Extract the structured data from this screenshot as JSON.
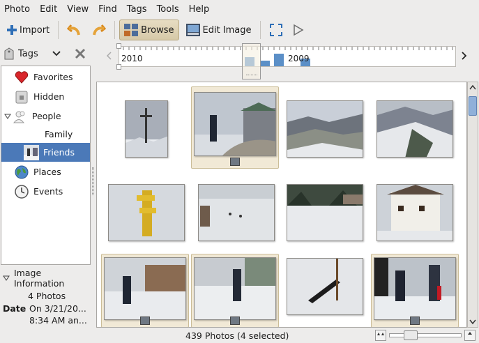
{
  "menu": [
    "Photo",
    "Edit",
    "View",
    "Find",
    "Tags",
    "Tools",
    "Help"
  ],
  "toolbar": {
    "import_label": "Import",
    "browse_label": "Browse",
    "edit_label": "Edit Image"
  },
  "sidebar": {
    "header_label": "Tags",
    "items": [
      {
        "label": "Favorites"
      },
      {
        "label": "Hidden"
      },
      {
        "label": "People"
      },
      {
        "label": "Family"
      },
      {
        "label": "Friends"
      },
      {
        "label": "Places"
      },
      {
        "label": "Events"
      }
    ]
  },
  "info": {
    "title": "Image Information",
    "count": "4 Photos",
    "date_key": "Date",
    "date_value_line1": "On 3/21/20...",
    "date_value_line2": "8:34 AM an..."
  },
  "timeline": {
    "year_left": "2010",
    "year_right": "2009",
    "bars": [
      0.55,
      0.35,
      0.75,
      0.45
    ]
  },
  "status": {
    "text": "439 Photos (4 selected)"
  },
  "colors": {
    "selection": "#4b79b8",
    "selected_cell": "#f1e9d6",
    "timeline_bar": "#5b8fc7"
  }
}
